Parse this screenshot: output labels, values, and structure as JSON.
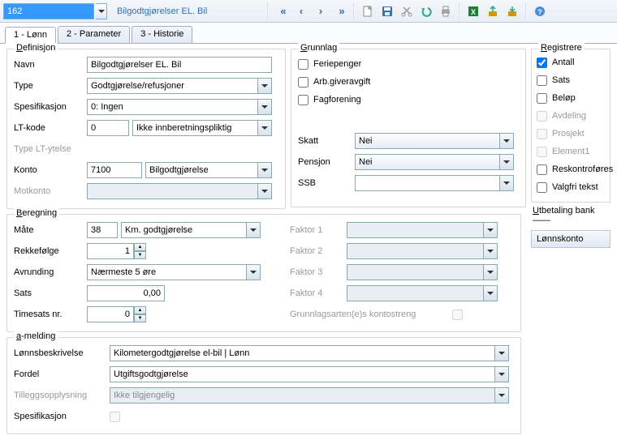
{
  "toolbar": {
    "id_value": "162",
    "title": "Bilgodtgjørelser EL. Bil"
  },
  "tabs": [
    "1 - Lønn",
    "2 - Parameter",
    "3 - Historie"
  ],
  "definisjon": {
    "title": "Definisjon",
    "navn_label": "Navn",
    "navn_value": "Bilgodtgjørelser EL. Bil",
    "type_label": "Type",
    "type_value": "Godtgjørelse/refusjoner",
    "spes_label": "Spesifikasjon",
    "spes_value": "0:  Ingen",
    "lt_label": "LT-kode",
    "lt_value": "0",
    "lt_text": "Ikke innberetningspliktig",
    "type_lt_label": "Type LT-ytelse",
    "konto_label": "Konto",
    "konto_value": "7100",
    "konto_text": "Bilgodtgjørelse",
    "motkonto_label": "Motkonto"
  },
  "grunnlag": {
    "title": "Grunnlag",
    "feriepenger": "Feriepenger",
    "arbgiver": "Arb.giveravgift",
    "fagforening": "Fagforening",
    "skatt_label": "Skatt",
    "skatt_value": "Nei",
    "pensjon_label": "Pensjon",
    "pensjon_value": "Nei",
    "ssb_label": "SSB",
    "ssb_value": ""
  },
  "registrere": {
    "title": "Registrere",
    "antall": "Antall",
    "sats": "Sats",
    "belop": "Beløp",
    "avdeling": "Avdeling",
    "prosjekt": "Prosjekt",
    "element1": "Element1",
    "reskontro": "Reskontroføres",
    "valgfri": "Valgfri tekst"
  },
  "utbetaling": {
    "title": "Utbetaling bank",
    "lonnskonto": "Lønnskonto"
  },
  "beregning": {
    "title": "Beregning",
    "mate_label": "Måte",
    "mate_value": "38",
    "mate_text": "Km. godtgjørelse",
    "rekke_label": "Rekkefølge",
    "rekke_value": "1",
    "avrunding_label": "Avrunding",
    "avrunding_value": "Nærmeste  5 øre",
    "sats_label": "Sats",
    "sats_value": "0,00",
    "timesats_label": "Timesats nr.",
    "timesats_value": "0",
    "faktor1": "Faktor 1",
    "faktor2": "Faktor 2",
    "faktor3": "Faktor 3",
    "faktor4": "Faktor 4",
    "grunnlag_kontostreng": "Grunnlagsarten(e)s kontostreng"
  },
  "amelding": {
    "title": "a-melding",
    "lonnsbesk_label": "Lønnsbeskrivelse",
    "lonnsbesk_value": "Kilometergodtgjørelse el-bil | Lønn",
    "fordel_label": "Fordel",
    "fordel_value": "Utgiftsgodtgjørelse",
    "tillegg_label": "Tilleggsopplysning",
    "tillegg_value": "Ikke tilgjengelig",
    "spes_label": "Spesifikasjon"
  }
}
